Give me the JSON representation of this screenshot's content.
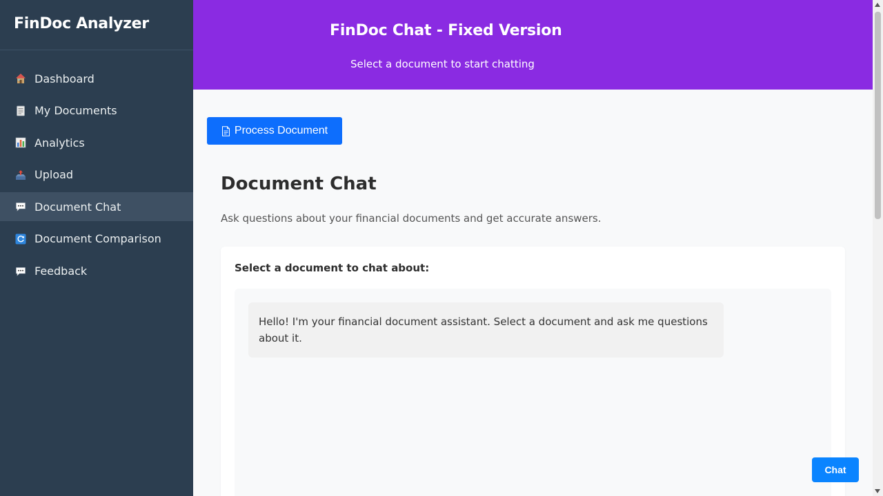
{
  "sidebar": {
    "brand": "FinDoc Analyzer",
    "items": [
      {
        "label": "Dashboard",
        "icon": "house-icon",
        "active": false
      },
      {
        "label": "My Documents",
        "icon": "document-icon",
        "active": false
      },
      {
        "label": "Analytics",
        "icon": "bar-chart-icon",
        "active": false
      },
      {
        "label": "Upload",
        "icon": "inbox-tray-icon",
        "active": false
      },
      {
        "label": "Document Chat",
        "icon": "speech-bubble-icon",
        "active": true
      },
      {
        "label": "Document Comparison",
        "icon": "refresh-icon",
        "active": false
      },
      {
        "label": "Feedback",
        "icon": "speech-bubble-icon",
        "active": false
      }
    ]
  },
  "header": {
    "title": "FinDoc Chat - Fixed Version",
    "subtitle": "Select a document to start chatting"
  },
  "main": {
    "process_button_label": "Process Document",
    "section_title": "Document Chat",
    "section_description": "Ask questions about your financial documents and get accurate answers.",
    "select_label": "Select a document to chat about:",
    "messages": [
      {
        "role": "assistant",
        "text": "Hello! I'm your financial document assistant. Select a document and ask me questions about it."
      }
    ]
  },
  "chat_fab_label": "Chat",
  "colors": {
    "sidebar_bg": "#2c3e50",
    "sidebar_active": "#3e5063",
    "header_bg": "#8a2be2",
    "primary_button": "#0d6efd",
    "chat_fab": "#0a84ff",
    "page_bg": "#f8f9fa"
  }
}
